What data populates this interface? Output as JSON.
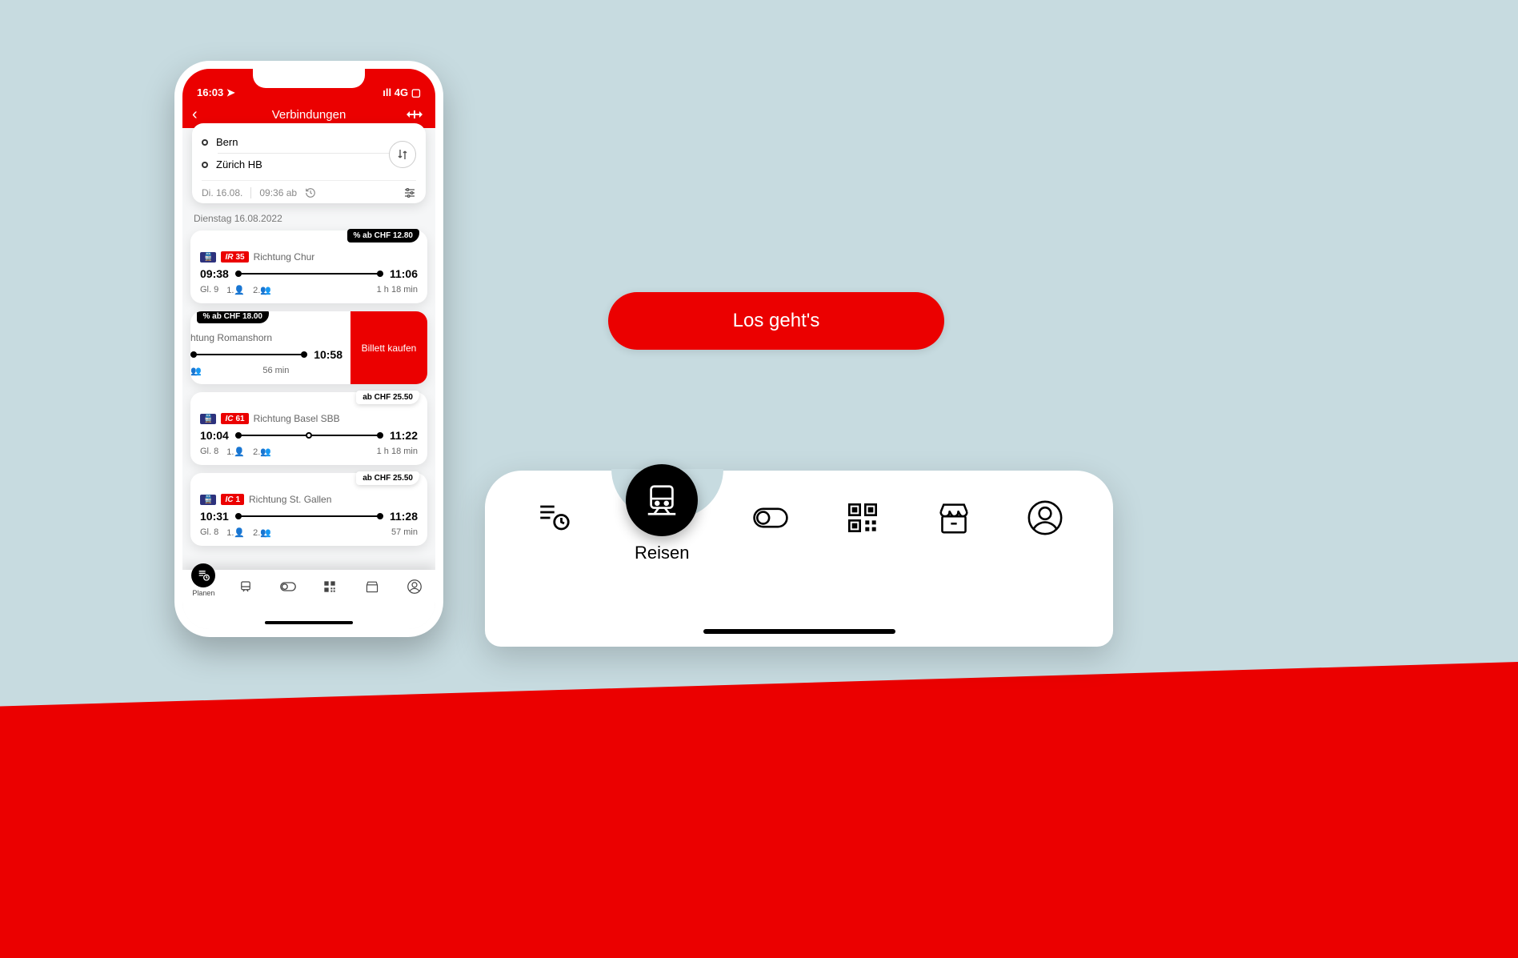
{
  "colors": {
    "accent": "#eb0000",
    "ink": "#000000"
  },
  "statusbar": {
    "time": "16:03",
    "network": "4G"
  },
  "header": {
    "title": "Verbindungen"
  },
  "search": {
    "from": "Bern",
    "to": "Zürich HB",
    "date": "Di. 16.08.",
    "time": "09:36 ab"
  },
  "section_date": "Dienstag 16.08.2022",
  "connections": [
    {
      "badge_type": "IR",
      "badge_no": "35",
      "direction": "Richtung Chur",
      "dep": "09:38",
      "arr": "11:06",
      "platform": "Gl. 9",
      "occ1": "1.",
      "occ2": "2.",
      "duration": "1 h 18 min",
      "price_prefix": "% ab CHF",
      "price": "12.80",
      "price_style": "dark"
    },
    {
      "badge_type": "",
      "badge_no": "",
      "direction": "chtung Romanshorn",
      "dep": "",
      "arr": "10:58",
      "platform": "",
      "occ1": "",
      "occ2": "",
      "duration": "56 min",
      "price_prefix": "% ab CHF",
      "price": "18.00",
      "price_style": "dark",
      "swipe_action": "Billett kaufen"
    },
    {
      "badge_type": "IC",
      "badge_no": "61",
      "direction": "Richtung Basel SBB",
      "dep": "10:04",
      "arr": "11:22",
      "platform": "Gl. 8",
      "occ1": "1.",
      "occ2": "2.",
      "duration": "1 h 18 min",
      "price_prefix": "ab CHF",
      "price": "25.50",
      "price_style": "white"
    },
    {
      "badge_type": "IC",
      "badge_no": "1",
      "direction": "Richtung St. Gallen",
      "dep": "10:31",
      "arr": "11:28",
      "platform": "Gl. 8",
      "occ1": "1.",
      "occ2": "2.",
      "duration": "57 min",
      "price_prefix": "ab CHF",
      "price": "25.50",
      "price_style": "white"
    }
  ],
  "phone_nav": {
    "active_label": "Planen",
    "items": [
      "Planen",
      "Reisen",
      "EasyRide",
      "Billette",
      "Shop",
      "Profil"
    ]
  },
  "cta": {
    "label": "Los geht's"
  },
  "nav_demo": {
    "active_label": "Reisen"
  }
}
